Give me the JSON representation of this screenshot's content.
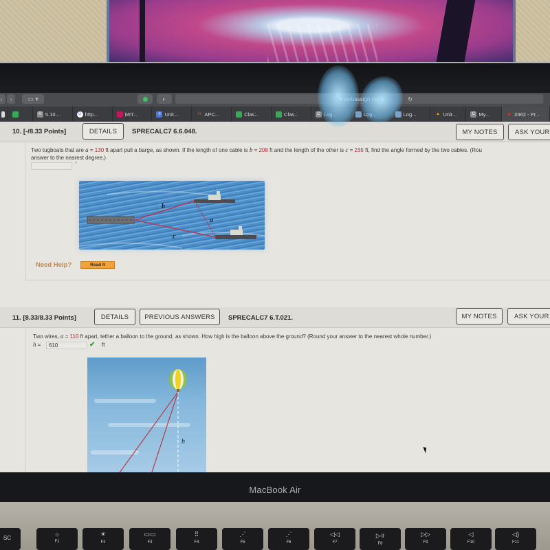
{
  "browser": {
    "url": "webassign.net",
    "tabs": [
      {
        "label": "",
        "icon": "tab-icon",
        "color": "#3aa757"
      },
      {
        "label": "5.10....",
        "icon": "R",
        "color": "#8c8c8c"
      },
      {
        "label": "http...",
        "icon": "G",
        "color": "#4285f4"
      },
      {
        "label": "MIT...",
        "icon": "M",
        "color": "#c2185b"
      },
      {
        "label": "Unit...",
        "icon": "≡",
        "color": "#4a79d8"
      },
      {
        "label": "APC...",
        "icon": "in",
        "color": "#d65d2a"
      },
      {
        "label": "Clas...",
        "icon": "▪",
        "color": "#3aa757"
      },
      {
        "label": "Clas...",
        "icon": "▪",
        "color": "#3aa757"
      },
      {
        "label": "Log...",
        "icon": "C",
        "color": "#8c8c8c"
      },
      {
        "label": "Log...",
        "icon": "▦",
        "color": "#7aa0c8"
      },
      {
        "label": "Log...",
        "icon": "▦",
        "color": "#7aa0c8"
      },
      {
        "label": "Unit...",
        "icon": "▲",
        "color": "#f4b400"
      },
      {
        "label": "My...",
        "icon": "C",
        "color": "#8c8c8c"
      },
      {
        "label": "#462 - Pr...",
        "icon": "✱",
        "color": "#d93025"
      }
    ]
  },
  "questions": [
    {
      "number": "10.",
      "points": "[-/8.33 Points]",
      "details_label": "DETAILS",
      "code": "SPRECALC7 6.6.048.",
      "my_notes_label": "MY NOTES",
      "ask_label": "ASK YOUR T",
      "text_line1_a": "Two tugboats that are ",
      "var_a": "a",
      "eq": " = ",
      "val_a": "130",
      "text_line1_b": " ft apart pull a barge, as shown. If the length of one cable is ",
      "var_b": "b",
      "val_b": "208",
      "text_line1_c": " ft and the length of the other is ",
      "var_c": "c",
      "val_c": "235",
      "text_line1_d": " ft, find the angle formed by the two cables. (Rou",
      "text_line2": "answer to the nearest degree.)",
      "answer_value": "",
      "unit": "°",
      "figure_labels": {
        "a": "a",
        "b": "b",
        "c": "c"
      },
      "need_help_label": "Need Help?",
      "read_it_label": "Read It"
    },
    {
      "number": "11.",
      "points": "[8.33/8.33 Points]",
      "details_label": "DETAILS",
      "previous_answers_label": "PREVIOUS ANSWERS",
      "code": "SPRECALC7 6.T.021.",
      "my_notes_label": "MY NOTES",
      "ask_label": "ASK YOUR T",
      "text_a": "Two wires, ",
      "var_a": "a",
      "eq": " = ",
      "val_a": "110",
      "text_b": "  ft apart, tether a balloon to the ground, as shown. How high is the balloon above the ground? (Round your answer to the nearest whole number.)",
      "answer_label": "h = ",
      "answer_value": "610",
      "answer_status": "correct",
      "unit": "ft",
      "figure_label_h": "h"
    }
  ],
  "device": {
    "brand": "MacBook Air",
    "fkeys": [
      {
        "glyph": "",
        "label": "esc"
      },
      {
        "glyph": "☼",
        "label": "F1"
      },
      {
        "glyph": "☀",
        "label": "F2"
      },
      {
        "glyph": "▭▭",
        "label": "F3"
      },
      {
        "glyph": "⠿",
        "label": "F4"
      },
      {
        "glyph": "⋰",
        "label": "F5"
      },
      {
        "glyph": "⋰",
        "label": "F6"
      },
      {
        "glyph": "◁◁",
        "label": "F7"
      },
      {
        "glyph": "▷॥",
        "label": "F8"
      },
      {
        "glyph": "▷▷",
        "label": "F9"
      },
      {
        "glyph": "◁",
        "label": "F10"
      },
      {
        "glyph": "◁)",
        "label": "F11"
      }
    ]
  }
}
